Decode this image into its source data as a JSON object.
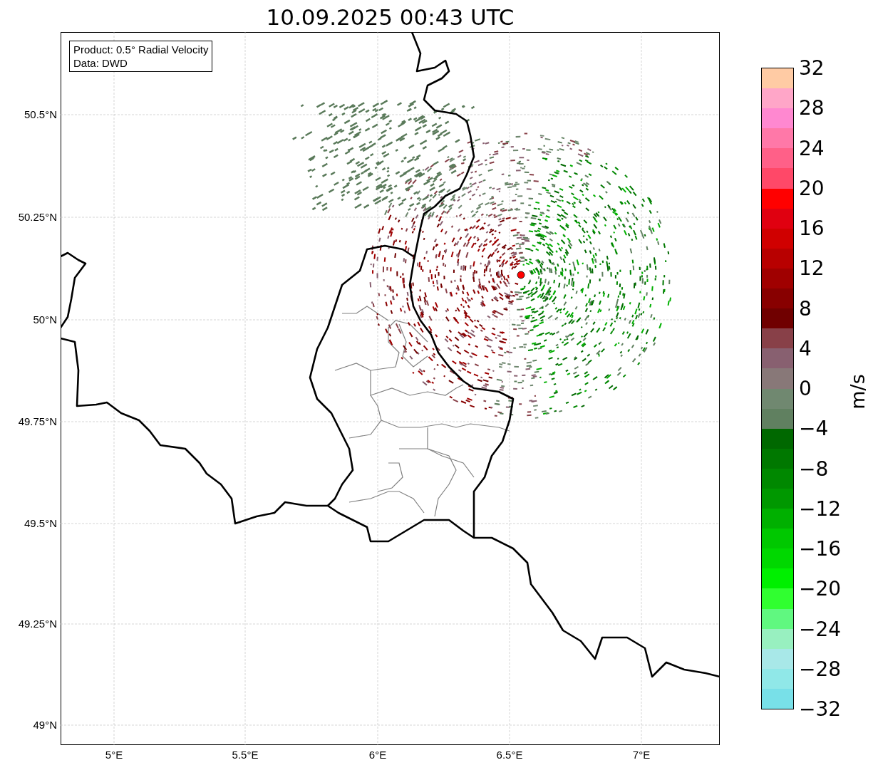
{
  "title": "10.09.2025 00:43 UTC",
  "info_box": [
    "Product: 0.5° Radial Velocity",
    "Data: DWD"
  ],
  "map": {
    "y_ticks": [
      "50.5°N",
      "50.25°N",
      "50°N",
      "49.75°N",
      "49.5°N",
      "49.25°N",
      "49°N"
    ],
    "x_ticks": [
      "5°E",
      "5.5°E",
      "6°E",
      "6.5°E",
      "7°E"
    ]
  },
  "colorbar": {
    "label": "m/s",
    "ticks": [
      "32",
      "28",
      "24",
      "20",
      "16",
      "12",
      "8",
      "4",
      "0",
      "−4",
      "−8",
      "−12",
      "−16",
      "−20",
      "−24",
      "−28",
      "−32"
    ],
    "segments": [
      {
        "color": "#ffcba4"
      },
      {
        "color": "#ffa6c8"
      },
      {
        "color": "#ff88d0"
      },
      {
        "color": "#ff78a8"
      },
      {
        "color": "#ff6088"
      },
      {
        "color": "#ff4868"
      },
      {
        "color": "#ff0000"
      },
      {
        "color": "#e00010"
      },
      {
        "color": "#d00000"
      },
      {
        "color": "#b80000"
      },
      {
        "color": "#a00000"
      },
      {
        "color": "#880000"
      },
      {
        "color": "#700000"
      },
      {
        "color": "#884048"
      },
      {
        "color": "#886070"
      },
      {
        "color": "#887878"
      },
      {
        "color": "#708870"
      },
      {
        "color": "#608060"
      },
      {
        "color": "#006800"
      },
      {
        "color": "#007800"
      },
      {
        "color": "#008800"
      },
      {
        "color": "#009800"
      },
      {
        "color": "#00b000"
      },
      {
        "color": "#00c800"
      },
      {
        "color": "#00d800"
      },
      {
        "color": "#00f000"
      },
      {
        "color": "#30ff30"
      },
      {
        "color": "#60f880"
      },
      {
        "color": "#98f0c0"
      },
      {
        "color": "#a8e8e8"
      },
      {
        "color": "#90e8e8"
      },
      {
        "color": "#78e0e8"
      }
    ]
  }
}
